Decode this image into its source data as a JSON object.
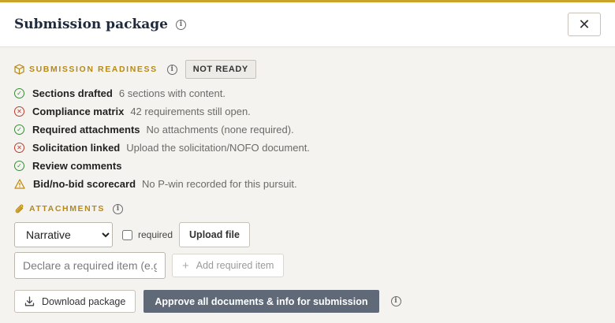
{
  "header": {
    "title": "Submission package",
    "info_icon": "info-icon",
    "close_icon": "close-icon",
    "close_glyph": "✕"
  },
  "readiness": {
    "label": "SUBMISSION READINESS",
    "badge": "NOT READY",
    "items": [
      {
        "status": "ok",
        "title": "Sections drafted",
        "detail": "6 sections with content."
      },
      {
        "status": "bad",
        "title": "Compliance matrix",
        "detail": "42 requirements still open."
      },
      {
        "status": "ok",
        "title": "Required attachments",
        "detail": "No attachments (none required)."
      },
      {
        "status": "bad",
        "title": "Solicitation linked",
        "detail": "Upload the solicitation/NOFO document."
      },
      {
        "status": "ok",
        "title": "Review comments",
        "detail": ""
      },
      {
        "status": "warn",
        "title": "Bid/no-bid scorecard",
        "detail": "No P-win recorded for this pursuit."
      }
    ]
  },
  "attachments": {
    "label": "ATTACHMENTS",
    "type_selected": "Narrative",
    "required_label": "required",
    "upload_label": "Upload file",
    "declare_placeholder": "Declare a required item (e.g",
    "add_label": "Add required item"
  },
  "footer": {
    "download_label": "Download package",
    "approve_label": "Approve all documents & info for submission"
  },
  "colors": {
    "accent": "#c9a227",
    "section_label": "#b68a17",
    "ok": "#3c8a3c",
    "bad": "#c0392b",
    "warn": "#c08a10",
    "primary_button": "#5f6978"
  }
}
